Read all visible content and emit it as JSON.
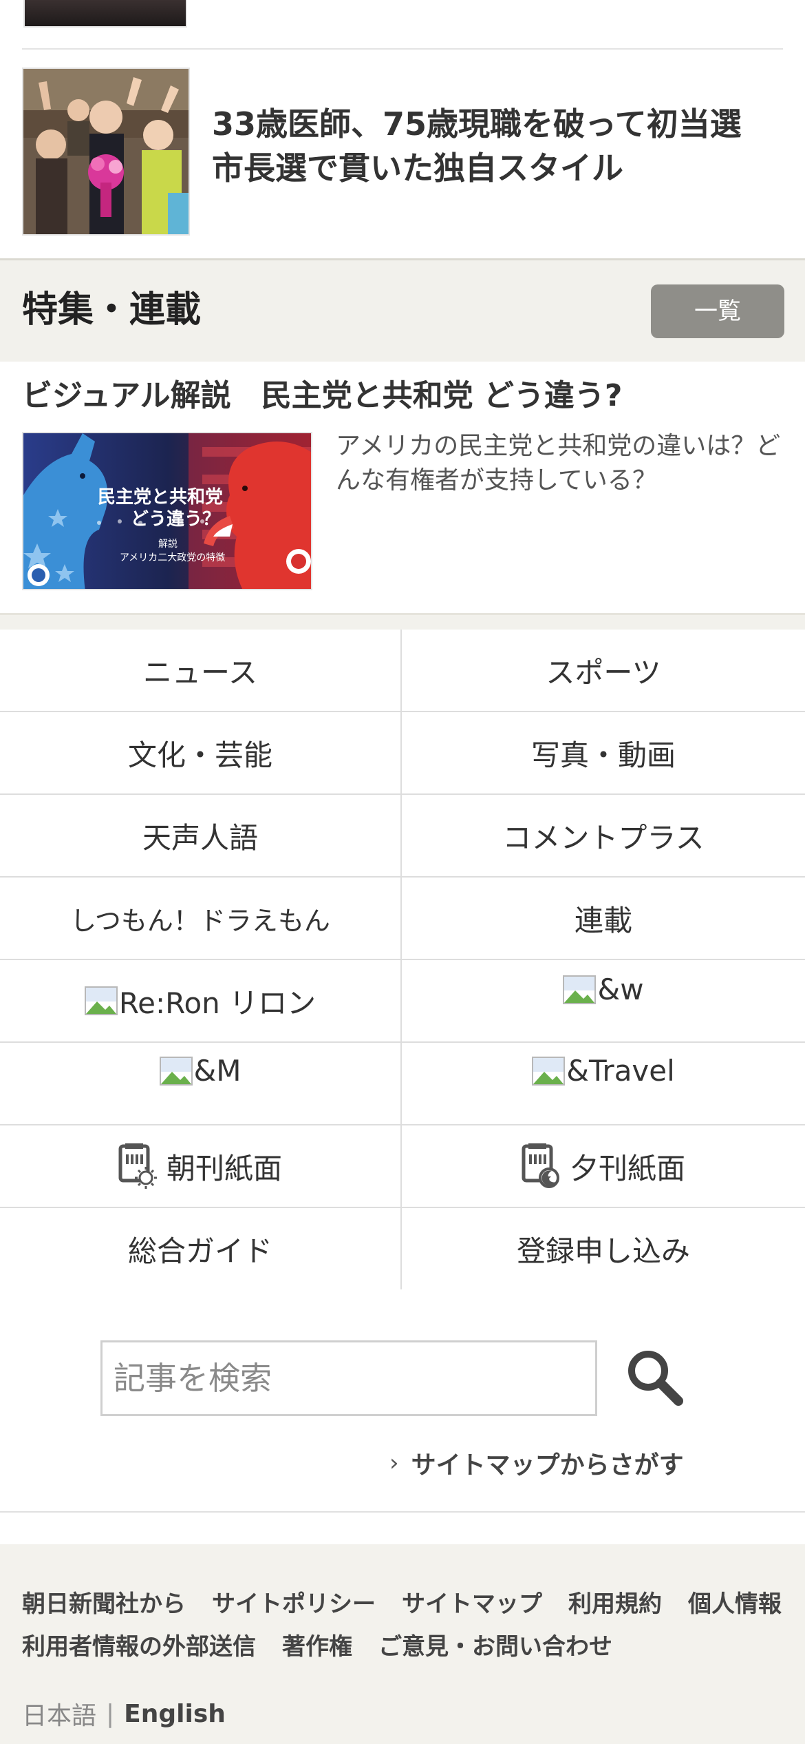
{
  "articles": [
    {
      "title_line1": "33歳医師、75歳現職を破って初当選",
      "title_line2": "市長選で貫いた独自スタイル"
    }
  ],
  "feature_section": {
    "title": "特集・連載",
    "list_button": "一覧",
    "card": {
      "title": "ビジュアル解説　民主党と共和党 どう違う?",
      "thumb_text": {
        "line1": "民主党と共和党",
        "line2": "どう違う？",
        "line3": "解説",
        "line4": "アメリカ二大政党の特徴"
      },
      "description": "アメリカの民主党と共和党の違いは？どんな有権者が支持している？"
    }
  },
  "nav": {
    "items": [
      {
        "label": "ニュース"
      },
      {
        "label": "スポーツ"
      },
      {
        "label": "文化・芸能"
      },
      {
        "label": "写真・動画"
      },
      {
        "label": "天声人語"
      },
      {
        "label": "コメントプラス"
      },
      {
        "label": "しつもん！ドラえもん"
      },
      {
        "label": "連載"
      },
      {
        "label": "Re:Ron リロン"
      },
      {
        "label": "&w"
      },
      {
        "label": "&M"
      },
      {
        "label": "&Travel"
      },
      {
        "label": "朝刊紙面"
      },
      {
        "label": "夕刊紙面"
      },
      {
        "label": "総合ガイド"
      },
      {
        "label": "登録申し込み"
      }
    ]
  },
  "search": {
    "placeholder": "記事を検索",
    "sitemap_link": "サイトマップからさがす"
  },
  "footer": {
    "row1": [
      "朝日新聞社から",
      "サイトポリシー",
      "サイトマップ",
      "利用規約",
      "個人情報"
    ],
    "row2": [
      "利用者情報の外部送信",
      "著作権",
      "ご意見・お問い合わせ"
    ],
    "lang": {
      "japanese": "日本語",
      "separator": "|",
      "english": "English"
    }
  },
  "colors": {
    "section_bg": "#f2f1ec",
    "button_bg": "#8f8e89",
    "text": "#333333",
    "democrat_blue": "#2a5fb0",
    "republican_red": "#d8312f"
  }
}
